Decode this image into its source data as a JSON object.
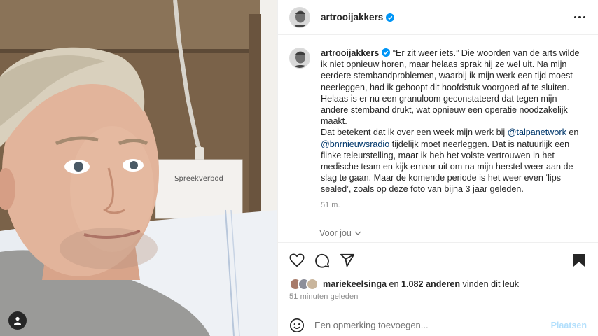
{
  "post": {
    "username": "artrooijakkers",
    "verified": true
  },
  "photo": {
    "sign_text": "Spreekverbod"
  },
  "caption": {
    "username": "artrooijakkers",
    "paragraph1": "“Er zit weer iets.” Die woorden van de arts wilde ik niet opnieuw horen, maar helaas sprak hij ze wel uit. Na mijn eerdere stembandproblemen, waarbij ik mijn werk een tijd moest neerleggen, had ik gehoopt dit hoofdstuk voorgoed af te sluiten. Helaas is er nu een granuloom geconstateerd dat tegen mijn andere stemband drukt, wat opnieuw een operatie noodzakelijk maakt.",
    "p2_before": "Dat betekent dat ik over een week mijn werk bij ",
    "mention1": "@talpanetwork",
    "p2_middle": " en ",
    "mention2": "@bnrnieuwsradio",
    "p2_after": " tijdelijk moet neerleggen. Dat is natuurlijk een flinke teleurstelling, maar ik heb het volste vertrouwen in het medische team en kijk ernaar uit om na mijn herstel weer aan de slag te gaan. Maar de komende periode is het weer even ‘lips sealed’, zoals op deze foto van bijna 3 jaar geleden.",
    "time": "51 m."
  },
  "translate_label": "Voor jou",
  "likes": {
    "liker": "mariekeelsinga",
    "middle": " en ",
    "others": "1.082 anderen",
    "suffix": " vinden dit leuk"
  },
  "posted_time": "51 minuten geleden",
  "comment": {
    "placeholder": "Een opmerking toevoegen...",
    "post_label": "Plaatsen"
  },
  "icons": {
    "like": "heart-icon",
    "comment": "comment-icon",
    "share": "share-icon",
    "save": "bookmark-icon",
    "emoji": "emoji-icon",
    "verified": "verified-badge-icon",
    "more": "more-icon",
    "tag": "user-tag-icon"
  },
  "colors": {
    "verified": "#0095f6",
    "mention": "#00376b",
    "post_button": "#b2dffc",
    "muted": "#8e8e8e"
  }
}
